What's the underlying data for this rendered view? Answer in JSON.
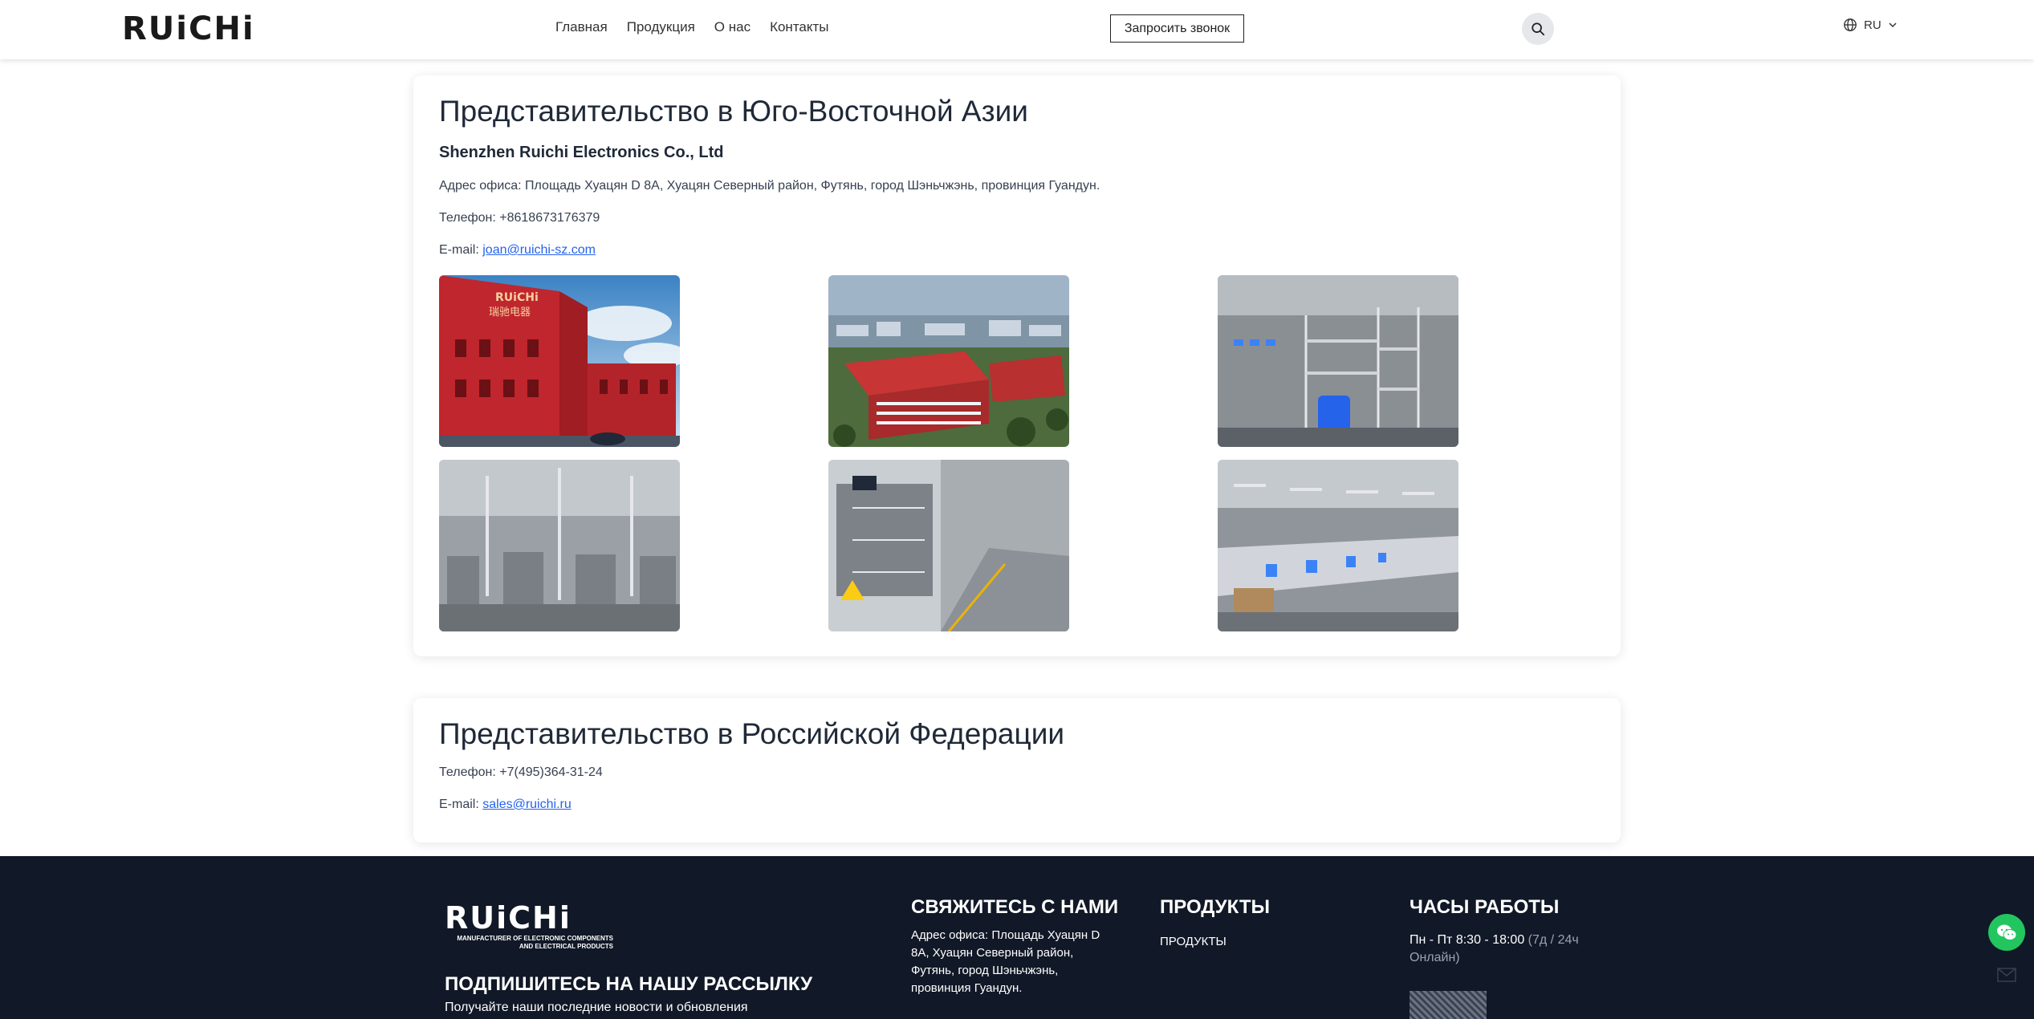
{
  "header": {
    "logo": "RUiCHi",
    "nav": [
      "Главная",
      "Продукция",
      "О нас",
      "Контакты"
    ],
    "callback_label": "Запросить звонок",
    "lang_label": "RU"
  },
  "asia": {
    "title": "Представительство в Юго-Восточной Азии",
    "company": "Shenzhen Ruichi Electronics Co., Ltd",
    "address": "Адрес офиса: Площадь Хуацян D 8A, Хуацян Северный район, Футянь, город Шэньчжэнь, провинция Гуандун.",
    "phone": "Телефон: +8618673176379",
    "email_label": "E-mail: ",
    "email": "joan@ruichi-sz.com",
    "sign_text": "RUiCHi",
    "sign_cn": "瑞驰电器"
  },
  "russia": {
    "title": "Представительство в Российской Федерации",
    "phone": "Телефон: +7(495)364-31-24",
    "email_label": "E-mail: ",
    "email": "sales@ruichi.ru"
  },
  "footer": {
    "logo": "RUiCHi",
    "logo_sub": "MANUFACTURER OF ELECTRONIC COMPONENTS AND ELECTRICAL PRODUCTS",
    "subscribe_title": "ПОДПИШИТЕСЬ НА НАШУ РАССЫЛКУ",
    "subscribe_text": "Получайте наши последние новости и обновления",
    "contact_title": "СВЯЖИТЕСЬ С НАМИ",
    "contact_address": "Адрес офиса: Площадь Хуацян D 8A, Хуацян Северный район, Футянь, город Шэньчжэнь, провинция Гуандун.",
    "products_title": "ПРОДУКТЫ",
    "products_link": "ПРОДУКТЫ",
    "hours_title": "ЧАСЫ РАБОТЫ",
    "hours": "Пн - Пт 8:30 - 18:00 ",
    "hours_extra": "(7д / 24ч Онлайн)"
  },
  "colors": {
    "accent_link": "#2563eb",
    "footer_bg": "#111827",
    "wechat": "#22c55e"
  },
  "icons": [
    "search-icon",
    "globe-icon",
    "chevron-down-icon",
    "wechat-icon",
    "mail-icon"
  ]
}
